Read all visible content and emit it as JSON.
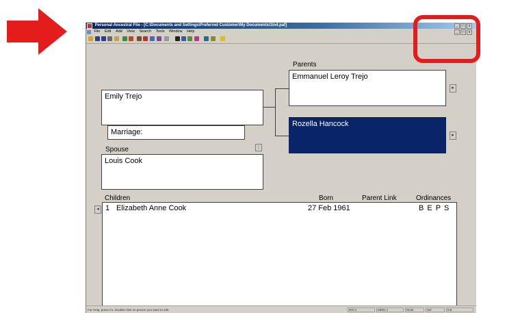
{
  "annotations": {
    "arrow_color": "#e51c1c",
    "highlight_color": "#e51c1c"
  },
  "window": {
    "title": "Personal Ancestral File - [C:\\Documents and Settings\\Preferred Customer\\My Documents\\1ln4.paf]",
    "title_icon": "paf-app-icon",
    "controls": [
      "_",
      "□",
      "x"
    ]
  },
  "menu": {
    "items": [
      "File",
      "Edit",
      "Add",
      "View",
      "Search",
      "Tools",
      "Window",
      "Help"
    ]
  },
  "toolbar": {
    "icons": [
      "open-icon",
      "save-icon",
      "save-as-icon",
      "print-icon",
      "backup-icon",
      "gedcom-icon",
      "family-view-icon",
      "pedigree-view-icon",
      "individual-list-icon",
      "family-list-icon",
      "multimedia-icon",
      "find-icon",
      "search-icon",
      "relationship-icon",
      "tree-icon",
      "sources-icon",
      "notes-icon",
      "merge-icon",
      "help-icon"
    ]
  },
  "family": {
    "parents_label": "Parents",
    "father": "Emmanuel Leroy Trejo",
    "mother": "Rozella Hancock",
    "individual": "Emily Trejo",
    "marriage_label": "Marriage:",
    "spouse_label": "Spouse",
    "spouse": "Louis Cook"
  },
  "children": {
    "headers": {
      "children": "Children",
      "born": "Born",
      "parent_link": "Parent Link",
      "ordinances": "Ordinances"
    },
    "rows": [
      {
        "num": "1",
        "name": "Elizabeth Anne Cook",
        "born": "27 Feb 1961",
        "parent_link": "",
        "ordinances": "B E P S"
      }
    ]
  },
  "status": {
    "help_text": "For Help, press F1. Double-click on person you want to edit.",
    "seg1": "RIN 4",
    "seg2": "MRIN 1",
    "seg3": "NUM",
    "seg4": "Sel",
    "seg5": "Ind"
  }
}
